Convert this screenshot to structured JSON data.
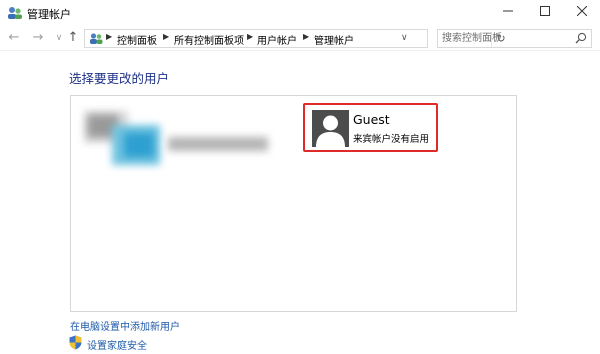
{
  "window": {
    "title": "管理帐户"
  },
  "address": {
    "breadcrumbs": [
      "控制面板",
      "所有控制面板项",
      "用户帐户",
      "管理帐户"
    ]
  },
  "search": {
    "placeholder": "搜索控制面板"
  },
  "main": {
    "heading": "选择要更改的用户",
    "guest": {
      "name": "Guest",
      "status": "来宾帐户没有启用"
    }
  },
  "links": {
    "add_user": "在电脑设置中添加新用户",
    "family_safety": "设置家庭安全"
  },
  "colors": {
    "highlight": "#e02a2a",
    "link": "#1e5aa8",
    "heading": "#1e3287"
  }
}
